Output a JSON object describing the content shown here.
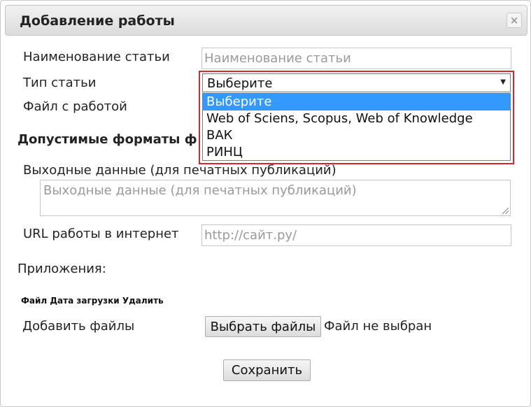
{
  "dialog": {
    "title": "Добавление работы",
    "close_glyph": "×"
  },
  "form": {
    "article_name": {
      "label": "Наименование статьи",
      "placeholder": "Наименование статьи"
    },
    "article_type": {
      "label": "Тип статьи",
      "selected": "Выберите",
      "options": [
        "Выберите",
        "Web of Sciens, Scopus, Web of Knowledge",
        "ВАК",
        "РИНЦ"
      ]
    },
    "file_label": "Файл с работой",
    "formats_heading": "Допустимые форматы ф",
    "output_data": {
      "label": "Выходные данные (для печатных публикаций)",
      "placeholder": "Выходные данные (для печатных публикаций)"
    },
    "url": {
      "label": "URL работы в интернет",
      "placeholder": "http://сайт.ру/"
    },
    "attachments_label": "Приложения:",
    "attachments_table_header": "Файл Дата загрузки Удалить",
    "add_files": {
      "label": "Добавить файлы",
      "button": "Выбрать файлы",
      "status": "Файл не выбран"
    },
    "save_button": "Сохранить"
  },
  "colors": {
    "selected_option_bg": "#3399ff",
    "dropdown_highlight_border": "#d9262e"
  }
}
